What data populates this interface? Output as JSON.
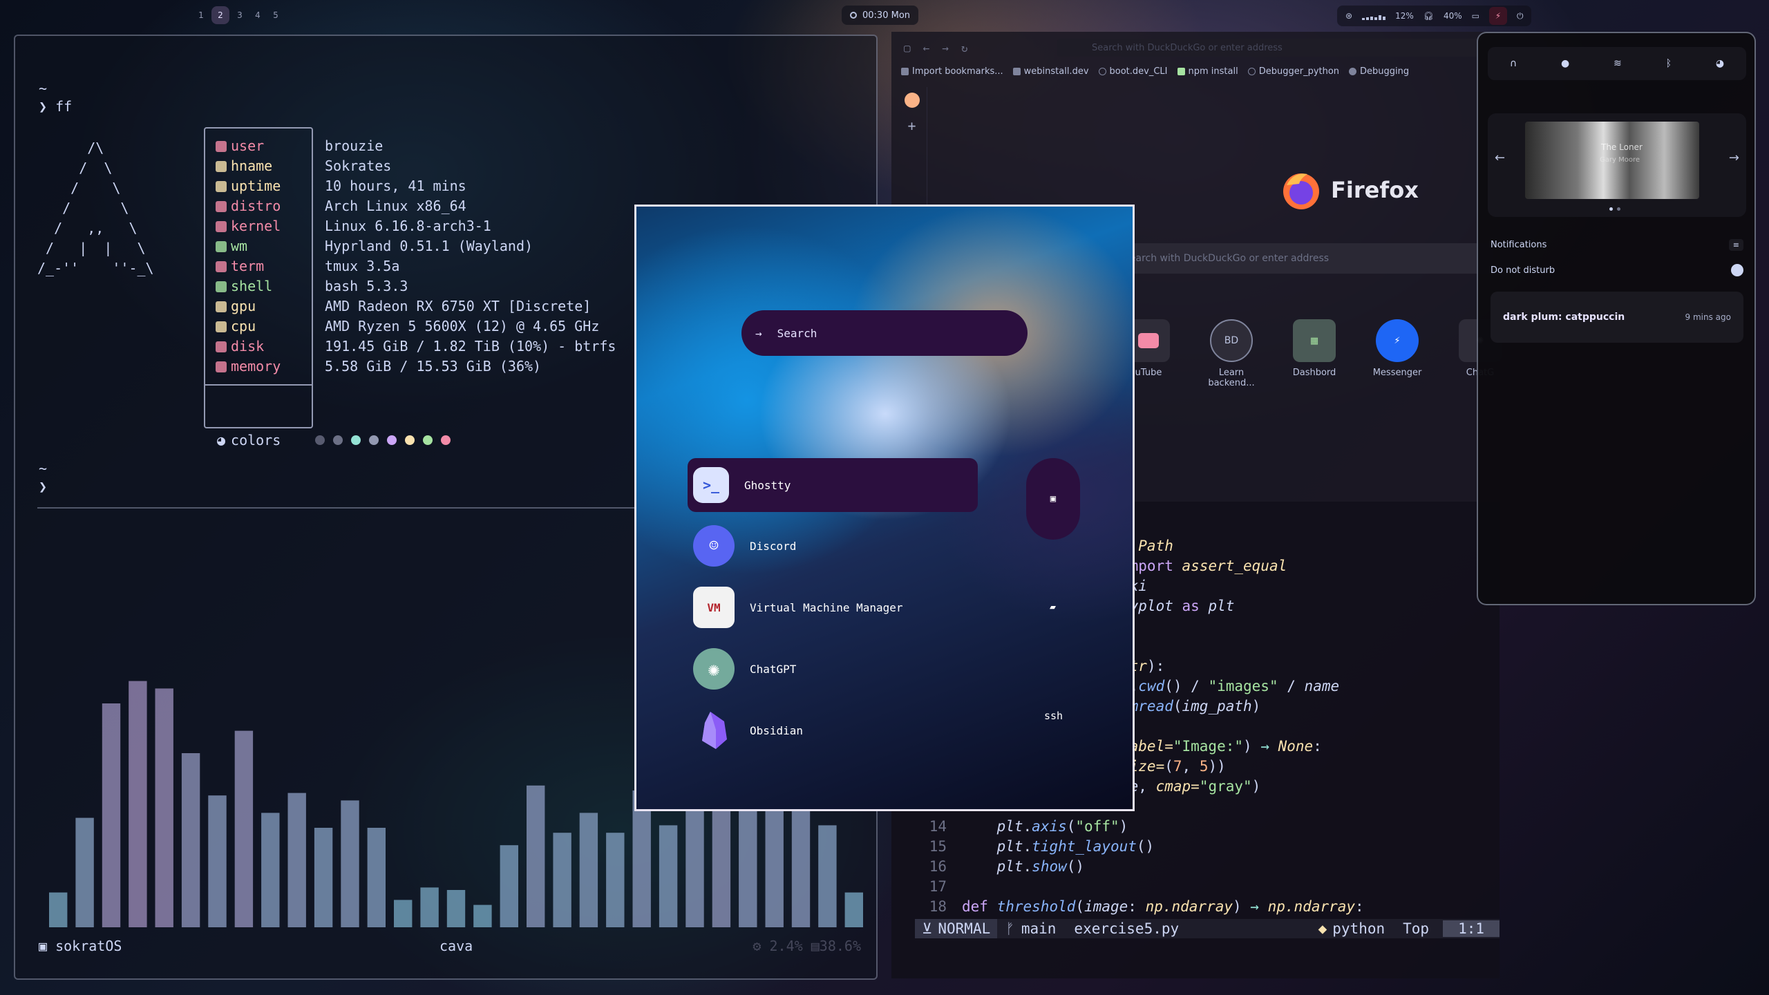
{
  "topbar": {
    "workspaces": [
      "1",
      "2",
      "3",
      "4",
      "5"
    ],
    "active_workspace": "2",
    "clock": "00:30 Mon",
    "cpu": "12%",
    "volume": "40%"
  },
  "terminal": {
    "home": "~",
    "command": "ff",
    "prompt_symbol": "❯",
    "ascii": "      /\\\n     /  \\\n    /    \\\n   /      \\\n  /   ,,   \\\n /   |  |   \\\n/_-''    ''-_\\",
    "fastfetch": [
      {
        "key": "user",
        "value": "brouzie",
        "color": "#f38ba8"
      },
      {
        "key": "hname",
        "value": "Sokrates",
        "color": "#f9e2af"
      },
      {
        "key": "uptime",
        "value": "10 hours, 41 mins",
        "color": "#f9e2af"
      },
      {
        "key": "distro",
        "value": "Arch Linux x86_64",
        "color": "#f38ba8"
      },
      {
        "key": "kernel",
        "value": "Linux 6.16.8-arch3-1",
        "color": "#f38ba8"
      },
      {
        "key": "wm",
        "value": "Hyprland 0.51.1 (Wayland)",
        "color": "#a6e3a1"
      },
      {
        "key": "term",
        "value": "tmux 3.5a",
        "color": "#f38ba8"
      },
      {
        "key": "shell",
        "value": "bash 5.3.3",
        "color": "#a6e3a1"
      },
      {
        "key": "gpu",
        "value": "AMD Radeon RX 6750 XT [Discrete]",
        "color": "#f9e2af"
      },
      {
        "key": "cpu",
        "value": "AMD Ryzen 5 5600X (12) @ 4.65 GHz",
        "color": "#f9e2af"
      },
      {
        "key": "disk",
        "value": "191.45 GiB / 1.82 TiB (10%) - btrfs",
        "color": "#f38ba8"
      },
      {
        "key": "memory",
        "value": "5.58 GiB / 15.53 GiB (36%)",
        "color": "#f38ba8"
      }
    ],
    "colors_label": "colors",
    "swatches": [
      "#585b70",
      "#6c7086",
      "#94e2d5",
      "#9399b2",
      "#cba6f7",
      "#f9e2af",
      "#a6e3a1",
      "#f38ba8"
    ],
    "cava_levels": [
      0.14,
      0.44,
      0.9,
      0.99,
      0.96,
      0.7,
      0.53,
      0.79,
      0.46,
      0.54,
      0.4,
      0.51,
      0.4,
      0.11,
      0.16,
      0.15,
      0.09,
      0.33,
      0.57,
      0.38,
      0.46,
      0.38,
      0.55,
      0.41,
      0.55,
      0.68,
      0.54,
      0.54,
      0.54,
      0.41,
      0.14
    ],
    "session": "sokratOS",
    "pane": "cava",
    "sys_cpu": "2.4%",
    "sys_mem": "38.6%"
  },
  "firefox": {
    "address_placeholder": "Search with DuckDuckGo or enter address",
    "bookmarks": [
      "Import bookmarks...",
      "webinstall.dev",
      "boot.dev_CLI",
      "npm install",
      "Debugger_python",
      "Debugging"
    ],
    "brand": "Firefox",
    "search_placeholder": "Search with DuckDuckGo or enter address",
    "tiles": [
      "uTube",
      "Learn backend...",
      "Dashbord",
      "Messenger",
      "ChatG"
    ]
  },
  "nvim": {
    "lines": [
      {
        "n": "",
        "html": "<span class='ty'>t Path</span>"
      },
      {
        "n": "",
        "html": "<span class='kw'>import</span> <span class='ty'>assert_equal</span>"
      },
      {
        "n": "",
        "html": "<span class='it'>ski</span>"
      },
      {
        "n": "",
        "html": "<span class='it'>pyplot</span> <span class='kw'>as</span> <span class='it'>plt</span>"
      },
      {
        "n": "",
        "html": ""
      },
      {
        "n": "",
        "html": ""
      },
      {
        "n": "",
        "html": "<span class='ty'>str</span>):"
      },
      {
        "n": "",
        "html": "h.<span class='fn'>cwd</span>() / <span class='str'>\"images\"</span> / <span class='it'>name</span>"
      },
      {
        "n": "",
        "html": "<span class='fn'>imread</span>(<span class='it'>img_path</span>)"
      },
      {
        "n": "",
        "html": ""
      },
      {
        "n": "",
        "html": "<span class='ty'>label=</span><span class='str'>\"Image:\"</span>) <span class='op'>→</span> <span class='ty'>None</span>:"
      },
      {
        "n": "",
        "html": "<span class='ty'>size=</span>(<span class='num'>7</span>, <span class='num'>5</span>))"
      },
      {
        "n": "",
        "html": "<span class='it'>ge</span>, <span class='ty'>cmap=</span><span class='str'>\"gray\"</span>)"
      },
      {
        "n": "",
        "html": ""
      },
      {
        "n": "14",
        "html": "    <span class='it'>plt</span>.<span class='fn'>axis</span>(<span class='str'>\"off\"</span>)"
      },
      {
        "n": "15",
        "html": "    <span class='it'>plt</span>.<span class='fn'>tight_layout</span>()"
      },
      {
        "n": "16",
        "html": "    <span class='it'>plt</span>.<span class='fn'>show</span>()"
      },
      {
        "n": "17",
        "html": ""
      },
      {
        "n": "18",
        "html": "<span class='kw'>def</span> <span class='fn'>threshold</span>(<span class='it'>image</span>: <span class='ty'>np.ndarray</span>) <span class='op'>→</span> <span class='ty'>np.ndarray</span>:"
      }
    ],
    "mode": "NORMAL",
    "branch": "main",
    "file": "exercise5.py",
    "filetype": "python",
    "position": "Top",
    "cursor": "1:1"
  },
  "control_center": {
    "now_playing": "The Loner",
    "artist": "Gary Moore",
    "notifications_label": "Notifications",
    "dnd_label": "Do not disturb",
    "notification_title": "dark plum: catppuccin",
    "notification_time": "9 mins ago"
  },
  "launcher": {
    "search_label": "Search",
    "apps": [
      "Ghostty",
      "Discord",
      "Virtual Machine Manager",
      "ChatGPT",
      "Obsidian"
    ],
    "aux_label": "ssh"
  }
}
